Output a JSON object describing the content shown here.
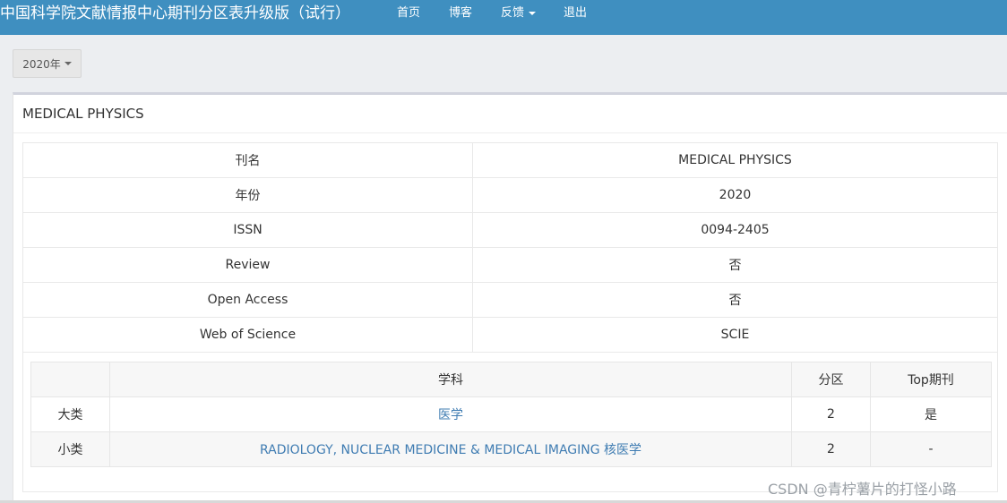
{
  "navbar": {
    "brand": "中国科学院文献情报中心期刊分区表升级版（试行）",
    "items": [
      "首页",
      "博客",
      "反馈",
      "退出"
    ]
  },
  "year_select": {
    "label": "2020年"
  },
  "panel": {
    "title": "MEDICAL PHYSICS"
  },
  "info_rows": [
    {
      "key": "刊名",
      "value": "MEDICAL PHYSICS"
    },
    {
      "key": "年份",
      "value": "2020"
    },
    {
      "key": "ISSN",
      "value": "0094-2405"
    },
    {
      "key": "Review",
      "value": "否"
    },
    {
      "key": "Open Access",
      "value": "否"
    },
    {
      "key": "Web of Science",
      "value": "SCIE"
    }
  ],
  "subject_table": {
    "headers": [
      "",
      "学科",
      "分区",
      "Top期刊"
    ],
    "rows": [
      {
        "category": "大类",
        "subject": "医学",
        "zone": "2",
        "top": "是"
      },
      {
        "category": "小类",
        "subject": "RADIOLOGY, NUCLEAR MEDICINE & MEDICAL IMAGING 核医学",
        "zone": "2",
        "top": "-"
      }
    ]
  },
  "watermark": "CSDN @青柠薯片的打怪小路",
  "colors": {
    "navbar": "#3f8fc0",
    "link": "#3f7cb2",
    "page_bg": "#eceef1"
  }
}
